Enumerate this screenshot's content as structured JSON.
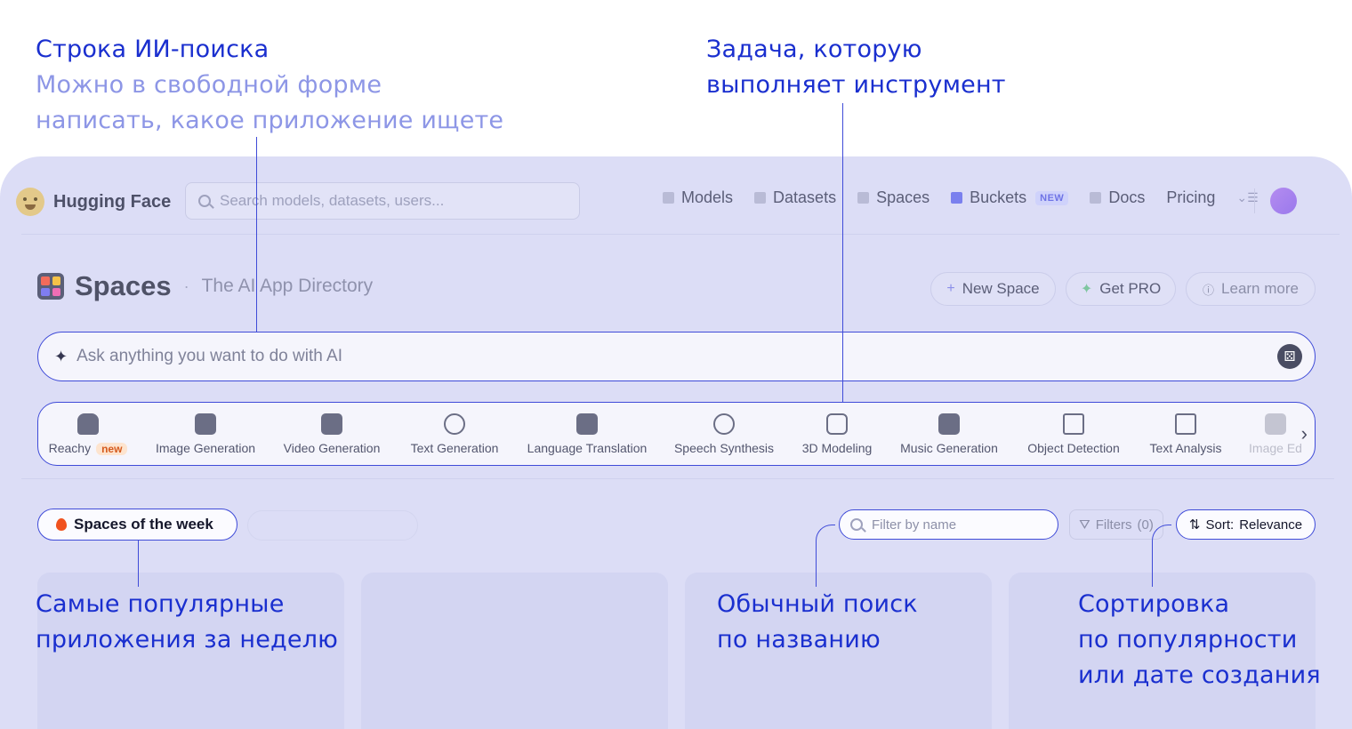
{
  "annotations": {
    "ai_search_title": "Строка ИИ-поиска",
    "ai_search_desc_1": "Можно в свободной форме",
    "ai_search_desc_2": "написать, какое приложение ищете",
    "task_1": "Задача, которую",
    "task_2": "выполняет инструмент",
    "week_1": "Самые популярные",
    "week_2": "приложения за неделю",
    "search_1": "Обычный поиск",
    "search_2": "по названию",
    "sort_1": "Сортировка",
    "sort_2": "по популярности",
    "sort_3": "или дате создания"
  },
  "header": {
    "brand": "Hugging Face",
    "search_placeholder": "Search models, datasets, users...",
    "nav": [
      {
        "label": "Models",
        "icon": "cube-icon"
      },
      {
        "label": "Datasets",
        "icon": "database-icon"
      },
      {
        "label": "Spaces",
        "icon": "grid-icon"
      },
      {
        "label": "Buckets",
        "icon": "bucket-icon",
        "badge": "NEW"
      },
      {
        "label": "Docs",
        "icon": "book-icon"
      },
      {
        "label": "Pricing"
      }
    ]
  },
  "page": {
    "title": "Spaces",
    "subtitle": "The AI App Directory",
    "new_space": "New Space",
    "get_pro": "Get PRO",
    "learn_more": "Learn more"
  },
  "ai_search": {
    "placeholder": "Ask anything you want to do with AI"
  },
  "categories": [
    {
      "label": "Reachy",
      "badge": "new"
    },
    {
      "label": "Image Generation"
    },
    {
      "label": "Video Generation"
    },
    {
      "label": "Text Generation"
    },
    {
      "label": "Language Translation"
    },
    {
      "label": "Speech Synthesis"
    },
    {
      "label": "3D Modeling"
    },
    {
      "label": "Music Generation"
    },
    {
      "label": "Object Detection"
    },
    {
      "label": "Text Analysis"
    },
    {
      "label": "Image Ed"
    }
  ],
  "toolbar": {
    "spaces_of_week": "Spaces of the week",
    "filter_placeholder": "Filter by name",
    "filters_label": "Filters",
    "filters_count": "(0)",
    "sort_label": "Sort:",
    "sort_value": "Relevance"
  },
  "colors": {
    "annotation": "#1a2fcf",
    "annotation_muted": "#8d96e6",
    "overlay": "#dcddf6",
    "highlight_border": "#3f4bd8"
  }
}
